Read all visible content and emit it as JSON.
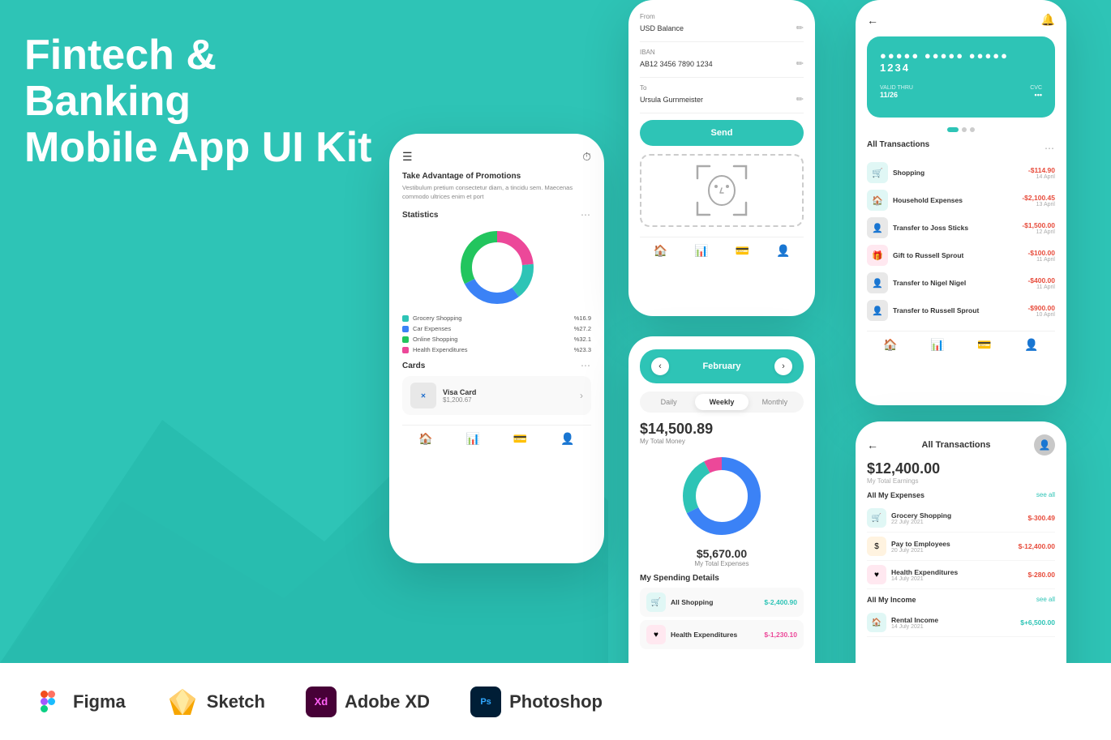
{
  "background": {
    "color": "#2ec4b6"
  },
  "title": {
    "line1": "Fintech & Banking",
    "line2": "Mobile App UI Kit"
  },
  "phone1": {
    "promo_title": "Take Advantage of Promotions",
    "promo_text": "Vestibulum pretium consectetur diam, a tincidu sem. Maecenas commodo ultrices enim et port",
    "statistics_label": "Statistics",
    "legend": [
      {
        "label": "Grocery Shopping",
        "pct": "%16.9",
        "color": "#2ec4b6"
      },
      {
        "label": "Car Expenses",
        "pct": "%27.2",
        "color": "#3b82f6"
      },
      {
        "label": "Online Shopping",
        "pct": "%32.1",
        "color": "#22c55e"
      },
      {
        "label": "Health Expenditures",
        "pct": "%23.3",
        "color": "#ec4899"
      }
    ],
    "cards_label": "Cards",
    "card_name": "Visa Card",
    "card_amount": "$1,200.67"
  },
  "phone2": {
    "from_label": "From",
    "from_value": "USD Balance",
    "iban_label": "IBAN",
    "iban_value": "AB12 3456 7890 1234",
    "to_label": "To",
    "to_value": "Ursula Gurnmeister",
    "send_btn": "Send"
  },
  "phone3": {
    "prev_btn": "‹",
    "next_btn": "›",
    "month": "February",
    "tabs": [
      "Daily",
      "Weekly",
      "Monthly"
    ],
    "active_tab": "Weekly",
    "total_money": "$14,500.89",
    "total_money_label": "My Total Money",
    "total_expenses": "$5,670.00",
    "total_expenses_label": "My Total Expenses",
    "spending_title": "My Spending Details",
    "spending_items": [
      {
        "name": "All Shopping",
        "amount": "$-2,400.90",
        "color": "#2ec4b6"
      },
      {
        "name": "Health Expenditures",
        "amount": "$-1,230.10",
        "color": "#ec4899"
      }
    ]
  },
  "phone4": {
    "card_number": "●●●●● ●●●●● ●●●●● 1234",
    "valid_thru_label": "VALID THRU",
    "valid_thru_value": "11/26",
    "cvc_label": "CVC",
    "cvc_value": "•••",
    "all_transactions_label": "All Transactions",
    "transactions": [
      {
        "name": "Shopping",
        "amount": "-$114.90",
        "date": "14 April",
        "icon": "🛒",
        "bg": "#e8f5f4"
      },
      {
        "name": "Household Expenses",
        "amount": "-$2,100.45",
        "date": "13 April",
        "icon": "🏠",
        "bg": "#e8f5f4"
      },
      {
        "name": "Transfer to Joss Sticks",
        "amount": "-$1,500.00",
        "date": "12 April",
        "icon": "👤",
        "bg": "#e8e8e8"
      },
      {
        "name": "Gift to Russell Sprout",
        "amount": "-$100.00",
        "date": "11 April",
        "icon": "🎁",
        "bg": "#ffe8f0"
      },
      {
        "name": "Transfer to Nigel Nigel",
        "amount": "-$400.00",
        "date": "11 April",
        "icon": "👤",
        "bg": "#e8e8e8"
      },
      {
        "name": "Transfer to Russell Sprout",
        "amount": "-$900.00",
        "date": "10 April",
        "icon": "👤",
        "bg": "#e8e8e8"
      }
    ]
  },
  "phone5": {
    "title": "All Transactions",
    "total_earnings": "$12,400.00",
    "total_earnings_label": "My Total Earnings",
    "all_expenses_label": "All My Expenses",
    "see_all": "see all",
    "expenses": [
      {
        "name": "Grocery Shopping",
        "date": "22 July 2021",
        "amount": "$-300.49",
        "icon": "🛒",
        "bg": "#e8f5f4"
      },
      {
        "name": "Pay to Employees",
        "date": "20 July 2021",
        "amount": "$-12,400.00",
        "icon": "$",
        "bg": "#fff3e0"
      },
      {
        "name": "Health Expenditures",
        "date": "14 July 2021",
        "amount": "$-280.00",
        "icon": "♥",
        "bg": "#ffe8f0"
      }
    ],
    "all_income_label": "All My Income",
    "income": [
      {
        "name": "Rental Income",
        "date": "14 July 2021",
        "amount": "$+6,500.00",
        "icon": "🏠",
        "bg": "#e8f5f4"
      }
    ]
  },
  "toolbar": {
    "tools": [
      {
        "name": "Figma",
        "icon_color": "#f24e1e",
        "icon_bg": "white"
      },
      {
        "name": "Sketch",
        "icon_color": "#f7a600",
        "icon_bg": "white"
      },
      {
        "name": "Adobe XD",
        "icon_color": "#ff61f6",
        "icon_bg": "#470137"
      },
      {
        "name": "Photoshop",
        "icon_color": "#31a8ff",
        "icon_bg": "#001e36"
      }
    ]
  }
}
